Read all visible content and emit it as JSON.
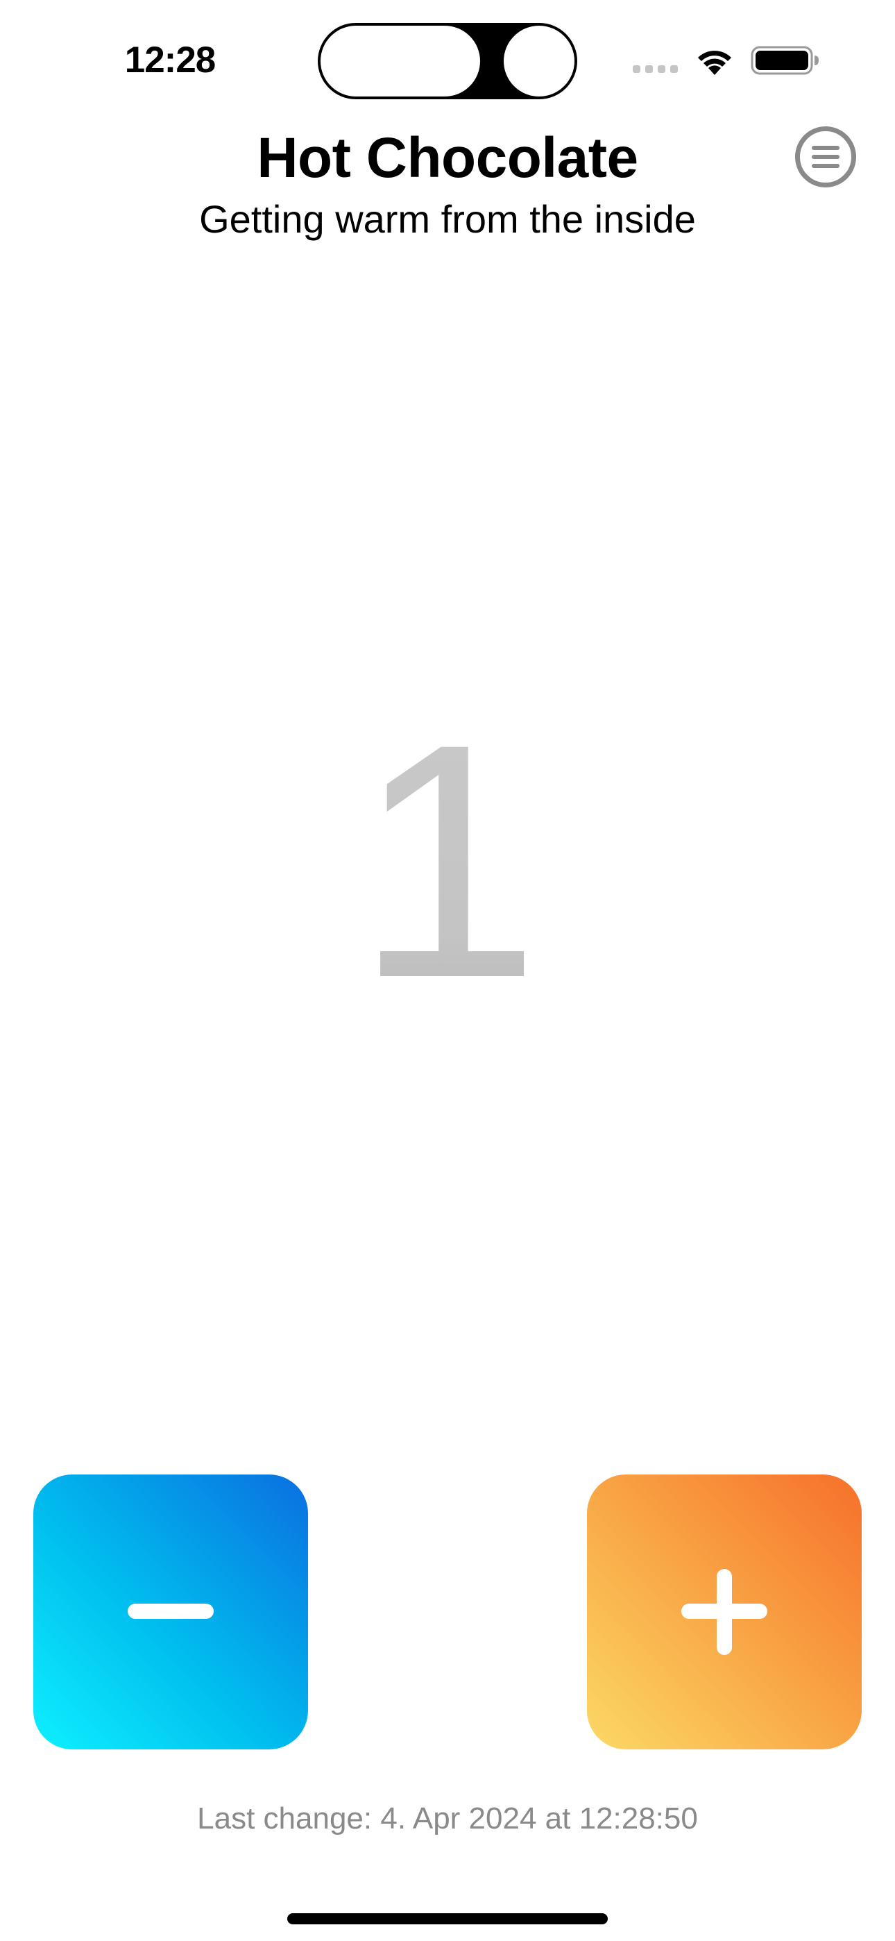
{
  "status_bar": {
    "time": "12:28",
    "signal_icon": "cellular-signal-icon",
    "wifi_icon": "wifi-icon",
    "battery_icon": "battery-icon"
  },
  "header": {
    "title": "Hot Chocolate",
    "subtitle": "Getting warm from the inside",
    "menu_icon": "menu-icon"
  },
  "counter": {
    "value": "1"
  },
  "controls": {
    "decrement_icon": "minus-icon",
    "increment_icon": "plus-icon",
    "decrement_gradient": [
      "#0ef0ff",
      "#00bdee",
      "#0a6fe0"
    ],
    "increment_gradient": [
      "#fbd966",
      "#f9a545",
      "#f6702a"
    ]
  },
  "footer": {
    "last_change": "Last change: 4. Apr 2024 at 12:28:50"
  }
}
